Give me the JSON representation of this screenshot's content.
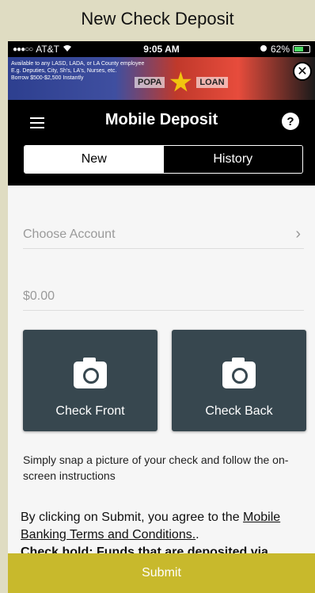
{
  "caption": "New Check Deposit",
  "status_bar": {
    "carrier": "AT&T",
    "time": "9:05 AM",
    "battery": "62%",
    "battery_level": 0.62
  },
  "ad": {
    "line1": "Available to any LASD, LADA, or LA County employee",
    "line2": "E.g. Deputies, City, Sh's, LA's, Nurses, etc.",
    "line3": "Borrow $500-$2,500 Instantly",
    "brand_left": "POPA",
    "brand_right": "LOAN",
    "close_glyph": "✕"
  },
  "header": {
    "title": "Mobile Deposit",
    "help_glyph": "?",
    "tabs": [
      {
        "label": "New",
        "active": true
      },
      {
        "label": "History",
        "active": false
      }
    ]
  },
  "form": {
    "account_placeholder": "Choose Account",
    "amount_placeholder": "$0.00",
    "check_front_label": "Check Front",
    "check_back_label": "Check Back",
    "instructions": "Simply snap a picture of your check and follow the on-screen instructions",
    "terms_prefix": "By clicking on Submit, you agree to the ",
    "terms_link": "Mobile Banking Terms and Conditions.",
    "terms_suffix": ".",
    "terms_cut_text": "Check hold: Funds that are deposited via",
    "submit_label": "Submit"
  },
  "colors": {
    "accent_submit": "#c8b92c",
    "camera_card": "#37474f",
    "header_bg": "#000000"
  }
}
